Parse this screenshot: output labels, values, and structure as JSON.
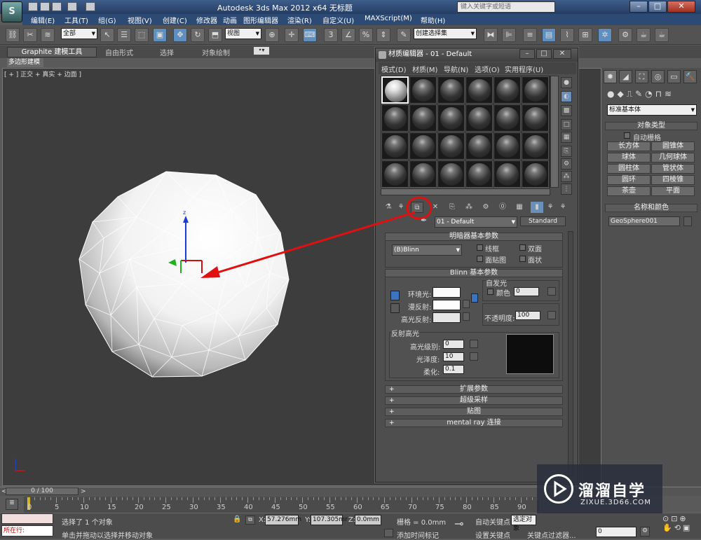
{
  "titlebar": {
    "app_title": "Autodesk 3ds Max  2012 x64     无标题",
    "search_placeholder": "键入关键字或短语",
    "app_button": "S"
  },
  "menubar": [
    "编辑(E)",
    "工具(T)",
    "组(G)",
    "视图(V)",
    "创建(C)",
    "修改器",
    "动画",
    "图形编辑器",
    "渲染(R)",
    "自定义(U)",
    "MAXScript(M)",
    "帮助(H)"
  ],
  "toolbar": {
    "selection_filter": "全部",
    "reference_coord": "视图",
    "named_selection": "创建选择集"
  },
  "ribbon": {
    "tabs": [
      "Graphite 建模工具",
      "自由形式",
      "选择",
      "对象绘制"
    ],
    "subtab": "多边形建模"
  },
  "viewport": {
    "label": "[ + ] 正交 + 真实 + 边面 ]"
  },
  "command_panel": {
    "category": "标准基本体",
    "object_type_header": "对象类型",
    "autogrid": "自动栅格",
    "objects": [
      "长方体",
      "圆锥体",
      "球体",
      "几何球体",
      "圆柱体",
      "管状体",
      "圆环",
      "四棱锥",
      "茶壶",
      "平面"
    ],
    "name_color_header": "名称和颜色",
    "object_name": "GeoSphere001"
  },
  "material_editor": {
    "title": "材质编辑器 - 01 - Default",
    "menus": [
      "模式(D)",
      "材质(M)",
      "导航(N)",
      "选项(O)",
      "实用程序(U)"
    ],
    "material_name": "01 - Default",
    "material_type": "Standard",
    "shader_header": "明暗器基本参数",
    "shader": "(B)Blinn",
    "wire": "线框",
    "two_sided": "双面",
    "face_map": "面贴图",
    "faceted": "面状",
    "blinn_header": "Blinn 基本参数",
    "self_illum": "自发光",
    "color_label": "颜色",
    "color_value": "0",
    "ambient": "环境光:",
    "diffuse": "漫反射:",
    "specular": "高光反射:",
    "opacity_label": "不透明度:",
    "opacity_value": "100",
    "highlights_header": "反射高光",
    "spec_level_label": "高光级别:",
    "spec_level_value": "0",
    "gloss_label": "光泽度:",
    "gloss_value": "10",
    "soften_label": "柔化:",
    "soften_value": "0.1",
    "extra_rollouts": [
      "扩展参数",
      "超级采样",
      "贴图",
      "mental ray 连接"
    ]
  },
  "timeline": {
    "slider": "0 / 100",
    "ticks": [
      "0",
      "5",
      "10",
      "15",
      "20",
      "25",
      "30",
      "35",
      "40",
      "45",
      "50",
      "55",
      "60",
      "65",
      "70",
      "75",
      "80",
      "85",
      "90"
    ]
  },
  "statusbar": {
    "listener": "所在行:",
    "status": "选择了 1 个对象",
    "prompt": "单击并拖动以选择并移动对象",
    "x_label": "X:",
    "x_value": "57.276mm",
    "y_label": "Y:",
    "y_value": "107.305mr",
    "z_label": "Z:",
    "z_value": "0.0mm",
    "grid": "栅格 = 0.0mm",
    "add_time_tag": "添加时间标记",
    "auto_key": "自动关键点",
    "set_key": "设置关键点",
    "selected": "选定对象",
    "key_filters": "关键点过滤器...",
    "frame": "0"
  },
  "watermark": {
    "text": "溜溜自学",
    "url": "ZIXUE.3D66.COM"
  },
  "colors": {
    "annotation_red": "#e01010",
    "title_blue": "#2c4a74"
  }
}
